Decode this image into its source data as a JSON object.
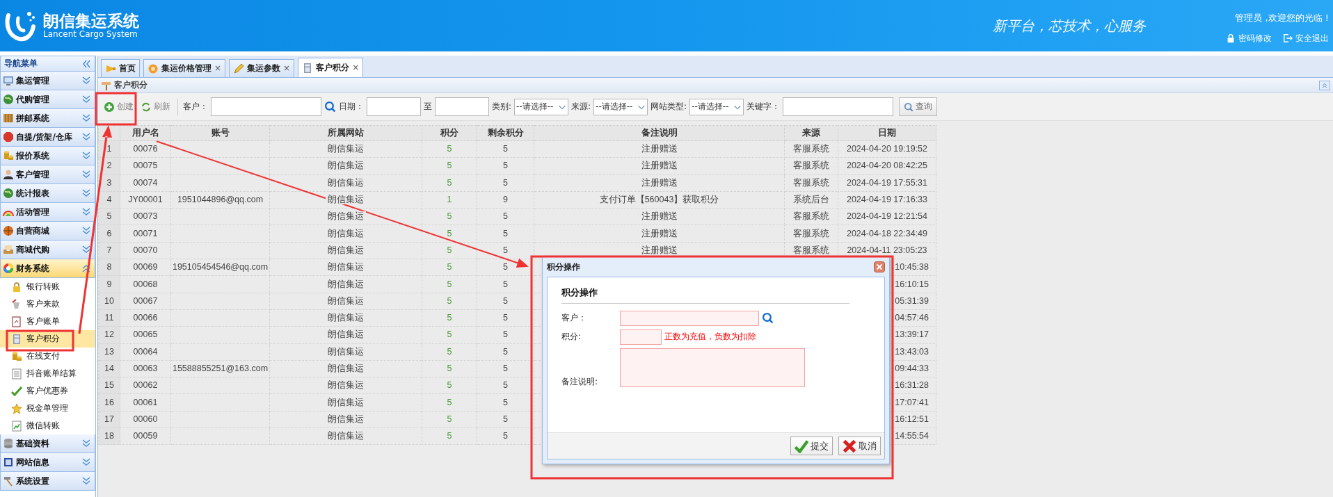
{
  "header": {
    "title": "朗信集运系统",
    "subtitle": "Lancent Cargo System",
    "slogan": "新平台，芯技术，心服务",
    "welcome": "管理员 ,欢迎您的光临 !",
    "links": [
      {
        "label": "密码修改"
      },
      {
        "label": "安全退出"
      }
    ]
  },
  "sidebar": {
    "title": "导航菜单",
    "items": [
      {
        "label": "集运管理",
        "expanded": false
      },
      {
        "label": "代购管理",
        "expanded": false
      },
      {
        "label": "拼邮系统",
        "expanded": false
      },
      {
        "label": "自提/货架/仓库",
        "expanded": false
      },
      {
        "label": "报价系统",
        "expanded": false
      },
      {
        "label": "客户管理",
        "expanded": false
      },
      {
        "label": "统计报表",
        "expanded": false
      },
      {
        "label": "活动管理",
        "expanded": false
      },
      {
        "label": "自营商城",
        "expanded": false
      },
      {
        "label": "商城代购",
        "expanded": false
      },
      {
        "label": "财务系统",
        "expanded": true,
        "children": [
          {
            "label": "银行转账",
            "selected": false
          },
          {
            "label": "客户来款",
            "selected": false
          },
          {
            "label": "客户账单",
            "selected": false
          },
          {
            "label": "客户积分",
            "selected": true
          },
          {
            "label": "在线支付",
            "selected": false
          },
          {
            "label": "抖音账单结算",
            "selected": false
          },
          {
            "label": "客户优惠券",
            "selected": false
          },
          {
            "label": "税金单管理",
            "selected": false
          },
          {
            "label": "微信转账",
            "selected": false
          }
        ]
      },
      {
        "label": "基础资料",
        "expanded": false
      },
      {
        "label": "网站信息",
        "expanded": false
      },
      {
        "label": "系统设置",
        "expanded": false
      }
    ]
  },
  "tabs": [
    {
      "label": "首页",
      "selected": false
    },
    {
      "label": "集运价格管理",
      "close": "×",
      "selected": false
    },
    {
      "label": "集运参数",
      "close": "×",
      "selected": false
    },
    {
      "label": "客户积分",
      "close": "×",
      "selected": true
    }
  ],
  "panel": {
    "title": "客户积分"
  },
  "toolbar": {
    "buttons": [
      {
        "label": "创建"
      },
      {
        "label": "刷新"
      }
    ],
    "filters": [
      {
        "kind": "label",
        "text": "客户："
      },
      {
        "kind": "text-input"
      },
      {
        "kind": "search"
      },
      {
        "kind": "label",
        "text": "日期："
      },
      {
        "kind": "date-input"
      },
      {
        "kind": "label",
        "text": "至"
      },
      {
        "kind": "date-input"
      },
      {
        "kind": "label",
        "text": "类别:"
      },
      {
        "kind": "select",
        "value": "--请选择--"
      },
      {
        "kind": "label",
        "text": "来源:"
      },
      {
        "kind": "select",
        "value": "--请选择--"
      },
      {
        "kind": "label",
        "text": "网站类型:"
      },
      {
        "kind": "select",
        "value": "--请选择--"
      },
      {
        "kind": "label",
        "text": "关键字："
      },
      {
        "kind": "text-input"
      },
      {
        "kind": "button",
        "text": "查询"
      }
    ]
  },
  "table": {
    "columns": [
      "用户名",
      "账号",
      "所属网站",
      "积分",
      "剩余积分",
      "备注说明",
      "来源",
      "日期"
    ],
    "rows": [
      {
        "no": "1",
        "username": "00076",
        "site": "朗信集运",
        "points": "5",
        "balance": "5",
        "remark": "注册赠送",
        "source": "客服系统",
        "date": "2024-04-20 19:19:52"
      },
      {
        "no": "2",
        "username": "00075",
        "site": "朗信集运",
        "points": "5",
        "balance": "5",
        "remark": "注册赠送",
        "source": "客服系统",
        "date": "2024-04-20 08:42:25"
      },
      {
        "no": "3",
        "username": "00074",
        "site": "朗信集运",
        "points": "5",
        "balance": "5",
        "remark": "注册赠送",
        "source": "客服系统",
        "date": "2024-04-19 17:55:31"
      },
      {
        "no": "4",
        "username": "JY00001",
        "account": "1951044896@qq.com",
        "site": "朗信集运",
        "points": "1",
        "balance": "9",
        "remark": "支付订单【560043】获取积分",
        "source": "系统后台",
        "date": "2024-04-19 17:16:33"
      },
      {
        "no": "5",
        "username": "00073",
        "site": "朗信集运",
        "points": "5",
        "balance": "5",
        "remark": "注册赠送",
        "source": "客服系统",
        "date": "2024-04-19 12:21:54"
      },
      {
        "no": "6",
        "username": "00071",
        "site": "朗信集运",
        "points": "5",
        "balance": "5",
        "remark": "注册赠送",
        "source": "客服系统",
        "date": "2024-04-18 22:34:49"
      },
      {
        "no": "7",
        "username": "00070",
        "site": "朗信集运",
        "points": "5",
        "balance": "5",
        "remark": "注册赠送",
        "source": "客服系统",
        "date": "2024-04-11 23:05:23"
      },
      {
        "no": "8",
        "username": "00069",
        "account": "195105454546@qq.com",
        "site": "朗信集运",
        "points": "5",
        "balance": "5",
        "date": "10:45:38"
      },
      {
        "no": "9",
        "username": "00068",
        "site": "朗信集运",
        "points": "5",
        "balance": "5",
        "date": "16:10:15"
      },
      {
        "no": "10",
        "username": "00067",
        "site": "朗信集运",
        "points": "5",
        "balance": "5",
        "date": "05:31:39"
      },
      {
        "no": "11",
        "username": "00066",
        "site": "朗信集运",
        "points": "5",
        "balance": "5",
        "date": "04:57:46"
      },
      {
        "no": "12",
        "username": "00065",
        "site": "朗信集运",
        "points": "5",
        "balance": "5",
        "date": "13:39:17"
      },
      {
        "no": "13",
        "username": "00064",
        "site": "朗信集运",
        "points": "5",
        "balance": "5",
        "date": "13:43:03"
      },
      {
        "no": "14",
        "username": "00063",
        "account": "15588855251@163.com",
        "site": "朗信集运",
        "points": "5",
        "balance": "5",
        "date": "09:44:33"
      },
      {
        "no": "15",
        "username": "00062",
        "site": "朗信集运",
        "points": "5",
        "balance": "5",
        "date": "16:31:28"
      },
      {
        "no": "16",
        "username": "00061",
        "site": "朗信集运",
        "points": "5",
        "balance": "5",
        "date": "17:07:41"
      },
      {
        "no": "17",
        "username": "00060",
        "site": "朗信集运",
        "points": "5",
        "balance": "5",
        "date": "16:12:51"
      },
      {
        "no": "18",
        "username": "00059",
        "site": "朗信集运",
        "points": "5",
        "balance": "5",
        "date": "14:55:54"
      }
    ]
  },
  "dialog": {
    "title": "积分操作",
    "heading": "积分操作",
    "fields": [
      {
        "kind": "text",
        "label": "客户：",
        "lookup": true
      },
      {
        "kind": "number",
        "label": "积分:",
        "hint": "正数为充值，负数为扣除"
      },
      {
        "kind": "textarea",
        "label": "备注说明:"
      }
    ],
    "buttons": [
      {
        "label": "提交",
        "kind": "submit"
      },
      {
        "label": "取消",
        "kind": "cancel"
      }
    ]
  }
}
